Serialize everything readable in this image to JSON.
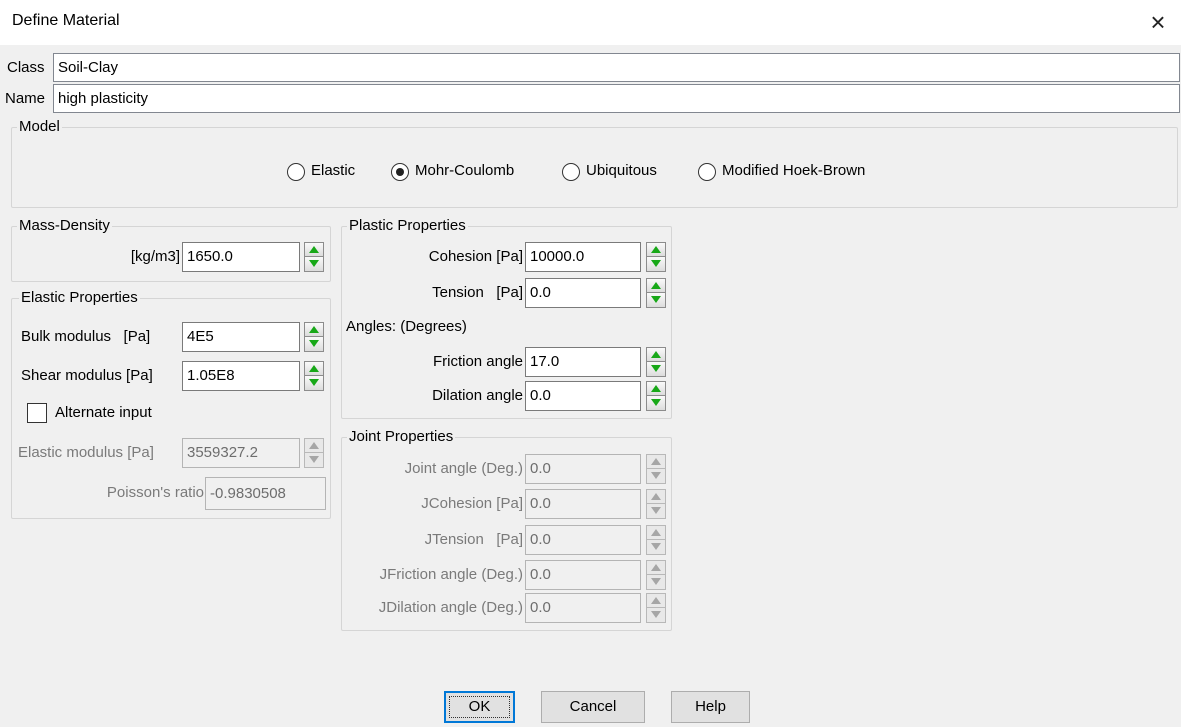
{
  "window": {
    "title": "Define Material",
    "close_glyph": "×"
  },
  "class_row": {
    "label": "Class",
    "value": "Soil-Clay"
  },
  "name_row": {
    "label": "Name",
    "value": "high plasticity"
  },
  "model": {
    "legend": "Model",
    "options": [
      "Elastic",
      "Mohr-Coulomb",
      "Ubiquitous",
      "Modified Hoek-Brown"
    ],
    "selected": "Mohr-Coulomb"
  },
  "mass_density": {
    "legend": "Mass-Density",
    "label": "[kg/m3]",
    "value": "1650.0"
  },
  "elastic": {
    "legend": "Elastic Properties",
    "bulk_label": "Bulk modulus   [Pa]",
    "bulk_value": "4E5",
    "shear_label": "Shear modulus [Pa]",
    "shear_value": "1.05E8",
    "alternate_label": "Alternate input",
    "alternate_checked": false,
    "elastic_label": "Elastic modulus [Pa]",
    "elastic_value": "3559327.2",
    "poisson_label": "Poisson's ratio",
    "poisson_value": "-0.9830508"
  },
  "plastic": {
    "legend": "Plastic Properties",
    "cohesion_label": "Cohesion [Pa]",
    "cohesion_value": "10000.0",
    "tension_label": "Tension   [Pa]",
    "tension_value": "0.0",
    "angles_label": "Angles: (Degrees)",
    "friction_label": "Friction angle",
    "friction_value": "17.0",
    "dilation_label": "Dilation angle",
    "dilation_value": "0.0"
  },
  "joint": {
    "legend": "Joint Properties",
    "rows": [
      {
        "label": "Joint angle (Deg.)",
        "value": "0.0"
      },
      {
        "label": "JCohesion [Pa]",
        "value": "0.0"
      },
      {
        "label": "JTension   [Pa]",
        "value": "0.0"
      },
      {
        "label": "JFriction angle (Deg.)",
        "value": "0.0"
      },
      {
        "label": "JDilation angle (Deg.)",
        "value": "0.0"
      }
    ]
  },
  "buttons": {
    "ok": "OK",
    "cancel": "Cancel",
    "help": "Help"
  },
  "icons": {
    "close": "close-icon",
    "spinner_up": "spinner-up-arrow",
    "spinner_down": "spinner-down-arrow"
  },
  "colors": {
    "spinner_arrow": "#18a818",
    "focus_border": "#0078d7",
    "background": "#f0f0f0"
  }
}
